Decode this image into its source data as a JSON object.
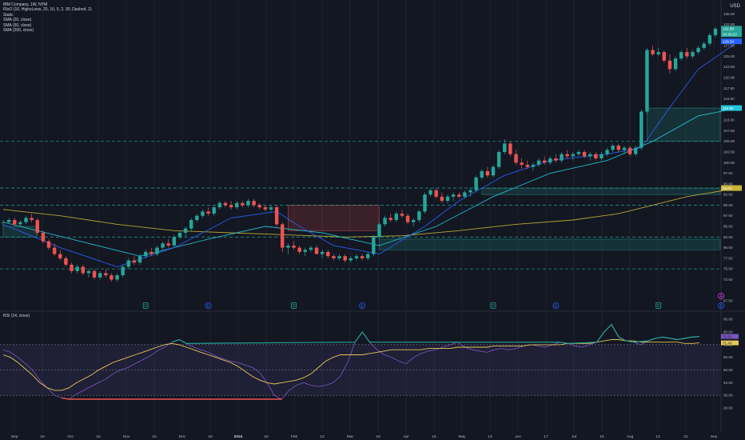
{
  "legend": {
    "title": "IBM Company, 1W, NYM",
    "lines": [
      "RIsO (10, HighsLows, 20, 10, 5, 2, 30, Dashed, 2)",
      "Static",
      "SMA (20, close)",
      "SMA (50, close)",
      "SMA (200, close)"
    ]
  },
  "currency": "USD",
  "rsi_label": "RSI (14, close)",
  "colors": {
    "background": "#131722",
    "up": "#26a69a",
    "down": "#ef5350",
    "sma20": "#2962ff",
    "sma50": "#26c6da",
    "sma200": "#c9b43a",
    "rsi": "#7e57c2",
    "rsi_ma": "#e3c75a",
    "level": "#26a69a"
  },
  "price_axis": {
    "ticks": [
      "135.00",
      "132.50",
      "130.00",
      "127.50",
      "125.00",
      "122.50",
      "120.00",
      "117.50",
      "115.00",
      "112.50",
      "110.00",
      "107.50",
      "105.00",
      "102.50",
      "100.00",
      "97.50",
      "95.00",
      "92.50",
      "90.00",
      "87.50",
      "85.00",
      "82.50",
      "80.00",
      "77.50",
      "75.00",
      "72.50",
      "67.50"
    ],
    "badges": [
      {
        "text": "131.50",
        "color": "#26a69a"
      },
      {
        "text": "04:40:22",
        "color": "#26a69a"
      },
      {
        "text": "128.54",
        "color": "#2962ff"
      },
      {
        "text": "112.84",
        "color": "#26c6da"
      },
      {
        "text": "94.02",
        "color": "#c9b43a"
      }
    ]
  },
  "rsi_axis": {
    "ticks": [
      "90.00",
      "80.00",
      "70.00",
      "60.00",
      "50.00",
      "40.00",
      "30.00",
      "20.00"
    ],
    "badges": [
      {
        "text": "76.51",
        "color": "#7e57c2"
      },
      {
        "text": "71.43",
        "color": "#e3c75a"
      }
    ]
  },
  "time_axis": {
    "labels": [
      "Sep",
      "18",
      "Oct",
      "16",
      "Nov",
      "15",
      "Dec",
      "18",
      "2024",
      "16",
      "Feb",
      "12",
      "Mar",
      "18",
      "Apr",
      "15",
      "May",
      "13",
      "Jun",
      "17",
      "Jul",
      "15",
      "Aug",
      "12",
      "21",
      "Sep"
    ]
  },
  "event_markers": [
    {
      "text": "D",
      "kind": "dividend"
    },
    {
      "text": "E",
      "kind": "earnings"
    },
    {
      "text": "D",
      "kind": "dividend"
    },
    {
      "text": "E",
      "kind": "earnings"
    },
    {
      "text": "D",
      "kind": "dividend"
    },
    {
      "text": "E",
      "kind": "earnings"
    },
    {
      "text": "D",
      "kind": "dividend"
    },
    {
      "text": "E",
      "kind": "earnings"
    },
    {
      "text": "A",
      "kind": "alert"
    }
  ],
  "chart_data": {
    "type": "candlestick",
    "x_axis": "weekly, Sep 2023 to Aug 2024",
    "y_range": [
      67.5,
      136
    ],
    "levels": [
      105,
      94.02,
      90,
      82.5,
      75
    ],
    "zones": [
      {
        "from": 0,
        "to": 6,
        "low": 82.5,
        "high": 85,
        "color": "up"
      },
      {
        "from": 50,
        "to": 66,
        "low": 84,
        "high": 90,
        "color": "down"
      },
      {
        "from": 66,
        "to": 130,
        "low": 79.5,
        "high": 82,
        "color": "up"
      },
      {
        "from": 84,
        "to": 130,
        "low": 92.5,
        "high": 94,
        "color": "up"
      },
      {
        "from": 113,
        "to": 130,
        "low": 105,
        "high": 112.84,
        "color": "up"
      }
    ],
    "candles": [
      [
        86,
        86.5,
        85,
        86
      ],
      [
        86,
        87,
        85.5,
        86.5
      ],
      [
        86.5,
        87,
        85,
        85.5
      ],
      [
        85.5,
        86.5,
        85,
        86
      ],
      [
        86,
        87.5,
        85.5,
        87
      ],
      [
        87,
        88,
        86,
        86.5
      ],
      [
        86.5,
        87,
        83,
        83.5
      ],
      [
        83.5,
        84,
        81,
        81.5
      ],
      [
        81.5,
        82,
        79.5,
        80
      ],
      [
        80,
        81,
        78,
        78.5
      ],
      [
        78.5,
        79.5,
        77,
        77.5
      ],
      [
        77.5,
        78,
        75.5,
        76
      ],
      [
        76,
        76.5,
        74,
        74.5
      ],
      [
        74.5,
        76,
        74,
        75.5
      ],
      [
        75.5,
        76,
        73.5,
        74
      ],
      [
        74,
        75,
        73,
        74.5
      ],
      [
        74.5,
        75,
        72.5,
        73
      ],
      [
        73,
        74.5,
        72.5,
        74
      ],
      [
        74,
        75,
        73,
        73.5
      ],
      [
        73.5,
        74,
        72,
        72.5
      ],
      [
        72.5,
        74,
        72,
        73.5
      ],
      [
        73.5,
        76,
        73,
        75.5
      ],
      [
        75.5,
        77.5,
        75,
        77
      ],
      [
        77,
        78,
        76,
        76.5
      ],
      [
        76.5,
        78.5,
        76,
        78
      ],
      [
        78,
        79.5,
        77.5,
        79
      ],
      [
        79,
        80,
        78,
        78.5
      ],
      [
        78.5,
        80.5,
        78,
        80
      ],
      [
        80,
        81.5,
        79.5,
        81
      ],
      [
        81,
        82,
        80,
        80.5
      ],
      [
        80.5,
        83,
        80,
        82.5
      ],
      [
        82.5,
        84,
        82,
        83.5
      ],
      [
        83.5,
        85,
        82.5,
        84.5
      ],
      [
        84.5,
        87,
        84,
        86.5
      ],
      [
        86.5,
        88,
        86,
        87.5
      ],
      [
        87.5,
        89,
        87,
        88.5
      ],
      [
        88.5,
        89.5,
        87.5,
        88
      ],
      [
        88,
        90,
        87.5,
        89.5
      ],
      [
        89.5,
        91,
        89,
        90.5
      ],
      [
        90.5,
        91,
        89.5,
        90
      ],
      [
        90,
        91,
        89,
        89.5
      ],
      [
        89.5,
        91,
        89,
        90.5
      ],
      [
        90.5,
        91,
        89.5,
        90
      ],
      [
        90,
        91.5,
        89.5,
        91
      ],
      [
        91,
        91.5,
        89.5,
        90
      ],
      [
        90,
        90.5,
        89,
        89.5
      ],
      [
        89.5,
        90,
        88.5,
        89
      ],
      [
        89,
        90,
        88.5,
        89.5
      ],
      [
        89.5,
        90,
        85,
        85.5
      ],
      [
        85.5,
        86,
        79,
        80
      ],
      [
        80,
        81,
        78.5,
        80.5
      ],
      [
        80.5,
        81.5,
        79.5,
        80
      ],
      [
        80,
        80.5,
        78.5,
        79
      ],
      [
        79,
        80,
        78,
        79.5
      ],
      [
        79.5,
        80.5,
        79,
        80
      ],
      [
        80,
        80.5,
        78.5,
        78.5
      ],
      [
        78.5,
        79.5,
        77.5,
        79
      ],
      [
        79,
        79.5,
        77.5,
        78
      ],
      [
        78,
        78.5,
        77,
        77.5
      ],
      [
        77.5,
        78.5,
        77,
        78
      ],
      [
        78,
        78.5,
        76.5,
        77
      ],
      [
        77,
        78,
        76.5,
        77.5
      ],
      [
        77.5,
        78.5,
        77,
        78
      ],
      [
        78,
        78.5,
        77,
        77.5
      ],
      [
        77.5,
        79,
        77,
        78.5
      ],
      [
        78.5,
        83,
        78,
        82.5
      ],
      [
        82.5,
        86,
        82,
        85.5
      ],
      [
        85.5,
        87.5,
        85,
        87
      ],
      [
        87,
        88,
        86,
        86.5
      ],
      [
        86.5,
        88.5,
        86,
        88
      ],
      [
        88,
        89,
        87,
        87.5
      ],
      [
        87.5,
        88,
        85.5,
        86
      ],
      [
        86,
        87,
        85,
        86.5
      ],
      [
        86.5,
        89,
        86,
        88.5
      ],
      [
        88.5,
        93,
        88,
        92.5
      ],
      [
        92.5,
        94,
        92,
        93.5
      ],
      [
        93.5,
        94,
        91.5,
        92
      ],
      [
        92,
        93,
        90.5,
        91
      ],
      [
        91,
        92.5,
        90.5,
        92
      ],
      [
        92,
        93,
        91,
        92.5
      ],
      [
        92.5,
        93,
        91.5,
        92
      ],
      [
        92,
        93.5,
        91.5,
        93
      ],
      [
        93,
        94,
        92,
        93.5
      ],
      [
        93.5,
        97,
        93,
        96.5
      ],
      [
        96.5,
        98.5,
        96,
        98
      ],
      [
        98,
        99,
        96.5,
        97
      ],
      [
        97,
        99.5,
        96.5,
        99
      ],
      [
        99,
        103,
        98.5,
        102.5
      ],
      [
        102.5,
        105.5,
        102,
        104.5
      ],
      [
        104.5,
        105,
        101.5,
        102
      ],
      [
        102,
        103,
        99.5,
        100
      ],
      [
        100,
        101,
        98.5,
        99.5
      ],
      [
        99.5,
        100.5,
        98.5,
        99
      ],
      [
        99,
        100,
        98,
        99.5
      ],
      [
        99.5,
        101,
        99,
        100.5
      ],
      [
        100.5,
        101.5,
        99.5,
        100
      ],
      [
        100,
        101.5,
        99.5,
        101
      ],
      [
        101,
        102,
        100,
        100.5
      ],
      [
        100.5,
        102.5,
        100,
        102
      ],
      [
        102,
        103,
        101,
        101.5
      ],
      [
        101.5,
        102.5,
        100.5,
        102
      ],
      [
        102,
        103,
        101.5,
        102.5
      ],
      [
        102.5,
        103,
        101,
        101.5
      ],
      [
        101.5,
        102.5,
        100.5,
        102
      ],
      [
        102,
        102.5,
        100.5,
        101
      ],
      [
        101,
        102.5,
        100.5,
        102
      ],
      [
        102,
        103.5,
        101.5,
        103
      ],
      [
        103,
        104.5,
        102.5,
        104
      ],
      [
        104,
        104.5,
        102.5,
        103
      ],
      [
        103,
        104,
        102,
        103.5
      ],
      [
        103.5,
        104,
        101.5,
        102
      ],
      [
        102,
        104,
        101.5,
        103.5
      ],
      [
        103.5,
        112.5,
        103,
        112
      ],
      [
        112,
        127,
        111.5,
        126.5
      ],
      [
        126.5,
        127.5,
        125,
        125.5
      ],
      [
        125.5,
        127,
        125,
        126
      ],
      [
        126,
        126.5,
        123.5,
        124
      ],
      [
        124,
        125.5,
        121,
        122
      ],
      [
        122,
        125,
        121.5,
        124.5
      ],
      [
        124.5,
        126.5,
        124,
        126
      ],
      [
        126,
        127,
        124.5,
        125
      ],
      [
        125,
        126.5,
        124.5,
        126
      ],
      [
        126,
        127.5,
        125.5,
        127
      ],
      [
        127,
        128.5,
        126.5,
        128
      ],
      [
        128,
        130.5,
        127.5,
        130
      ],
      [
        130,
        132,
        129.5,
        131.5
      ]
    ],
    "sma20": [
      [
        0,
        85.5
      ],
      [
        10,
        80
      ],
      [
        20,
        75.5
      ],
      [
        30,
        80
      ],
      [
        40,
        87
      ],
      [
        48,
        88.5
      ],
      [
        52,
        85
      ],
      [
        58,
        80.5
      ],
      [
        66,
        78.5
      ],
      [
        74,
        85
      ],
      [
        80,
        91
      ],
      [
        88,
        97
      ],
      [
        96,
        100.5
      ],
      [
        106,
        102
      ],
      [
        112,
        103.5
      ],
      [
        117,
        113
      ],
      [
        122,
        122
      ],
      [
        129,
        128.5
      ]
    ],
    "sma50": [
      [
        0,
        86
      ],
      [
        12,
        82
      ],
      [
        24,
        78
      ],
      [
        36,
        82
      ],
      [
        46,
        85
      ],
      [
        56,
        83.5
      ],
      [
        66,
        80.5
      ],
      [
        76,
        85
      ],
      [
        86,
        92
      ],
      [
        96,
        97.5
      ],
      [
        106,
        100.5
      ],
      [
        114,
        105
      ],
      [
        122,
        111
      ],
      [
        129,
        112.84
      ]
    ],
    "sma200": [
      [
        0,
        89
      ],
      [
        10,
        87.5
      ],
      [
        20,
        85.5
      ],
      [
        30,
        84
      ],
      [
        40,
        83.5
      ],
      [
        50,
        83
      ],
      [
        60,
        82.5
      ],
      [
        70,
        82.8
      ],
      [
        80,
        84
      ],
      [
        90,
        85.5
      ],
      [
        100,
        86.5
      ],
      [
        108,
        88
      ],
      [
        114,
        90
      ],
      [
        120,
        92
      ],
      [
        129,
        94.02
      ]
    ],
    "rsi": [
      66,
      64,
      60,
      55,
      50,
      42,
      36,
      30,
      28,
      27,
      31,
      34,
      37,
      40,
      43,
      47,
      50,
      52,
      55,
      58,
      61,
      65,
      68,
      72,
      74,
      71,
      68,
      66,
      64,
      61,
      59,
      57,
      56,
      54,
      52,
      48,
      40,
      30,
      27,
      34,
      38,
      40,
      38,
      37,
      38,
      40,
      45,
      56,
      72,
      80,
      72,
      66,
      62,
      60,
      57,
      55,
      60,
      63,
      65,
      66,
      68,
      70,
      72,
      68,
      66,
      65,
      64,
      66,
      67,
      66,
      67,
      69,
      70,
      69,
      68,
      70,
      72,
      71,
      69,
      68,
      70,
      72,
      80,
      86,
      76,
      73,
      72,
      70,
      73,
      75,
      76,
      75,
      74,
      75,
      76,
      76.51
    ],
    "rsi_ma": [
      62,
      60,
      56,
      51,
      46,
      40,
      36,
      34,
      34,
      36,
      40,
      43,
      46,
      50,
      53,
      56,
      58,
      60,
      62,
      64,
      66,
      68,
      70,
      71,
      70,
      68,
      66,
      64,
      62,
      60,
      58,
      56,
      53,
      49,
      45,
      42,
      40,
      39,
      40,
      41,
      42,
      44,
      47,
      52,
      57,
      60,
      62,
      62,
      62,
      62,
      63,
      64,
      65,
      66,
      66,
      66,
      66,
      66,
      67,
      67,
      67,
      67,
      68,
      68,
      68,
      68,
      68,
      69,
      69,
      69,
      69,
      69,
      70,
      70,
      70,
      70,
      70,
      71,
      71,
      71,
      71,
      72,
      73,
      74,
      74,
      73,
      73,
      72,
      72,
      72,
      72,
      72,
      72,
      71,
      71,
      71.43
    ],
    "rsi_levels": {
      "upper": 70,
      "lower": 30,
      "mid": 50
    },
    "rsi_range": [
      15,
      92
    ]
  }
}
